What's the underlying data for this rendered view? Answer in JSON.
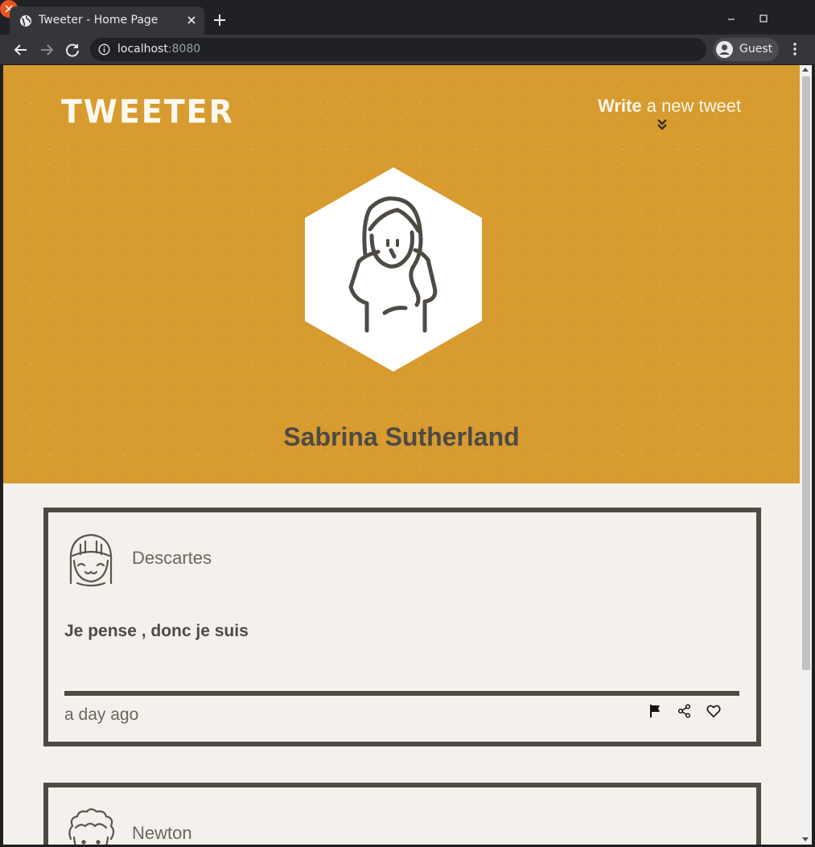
{
  "browser": {
    "tab_title": "Tweeter - Home Page",
    "url_host": "localhost",
    "url_port": ":8080",
    "profile_label": "Guest"
  },
  "header": {
    "logo": "TWEETER",
    "write_bold": "Write",
    "write_rest": " a new tweet"
  },
  "profile": {
    "name": "Sabrina Sutherland"
  },
  "tweets": [
    {
      "author": "Descartes",
      "text": "Je pense , donc je suis",
      "time": "a day ago"
    },
    {
      "author": "Newton"
    }
  ],
  "colors": {
    "hero": "#d79b30",
    "ink": "#4e4a44",
    "page": "#f4f1ec"
  }
}
